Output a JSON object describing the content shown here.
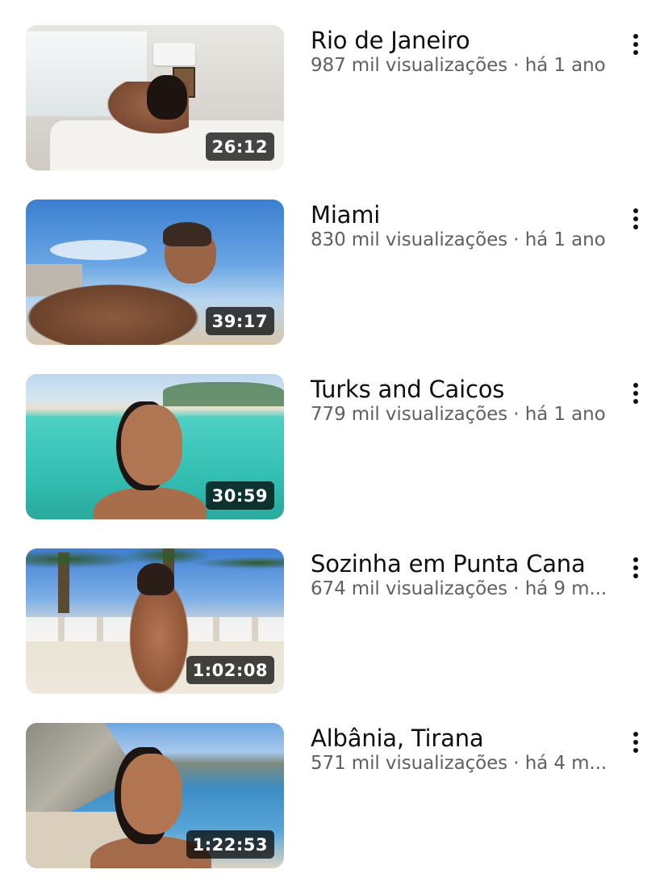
{
  "videos": [
    {
      "title": "Rio de Janeiro",
      "subtitle": "987 mil visualizações · há 1 ano",
      "duration": "26:12",
      "thumbnail": "bedroom-scene"
    },
    {
      "title": "Miami",
      "subtitle": "830 mil visualizações · há 1 ano",
      "duration": "39:17",
      "thumbnail": "miami-beach-scene"
    },
    {
      "title": "Turks and Caicos",
      "subtitle": "779 mil visualizações · há 1 ano",
      "duration": "30:59",
      "thumbnail": "turquoise-water-scene"
    },
    {
      "title": "Sozinha em Punta Cana",
      "subtitle": "674 mil visualizações · há 9 m...",
      "duration": "1:02:08",
      "thumbnail": "resort-beach-scene"
    },
    {
      "title": "Albânia, Tirana",
      "subtitle": "571 mil visualizações · há 4 m...",
      "duration": "1:22:53",
      "thumbnail": "coastal-cliff-scene"
    }
  ],
  "icons": {
    "more": "more-vertical-icon"
  },
  "colors": {
    "title": "#0f0f0f",
    "subtitle": "#606060",
    "duration_bg": "#000000",
    "background": "#ffffff"
  }
}
